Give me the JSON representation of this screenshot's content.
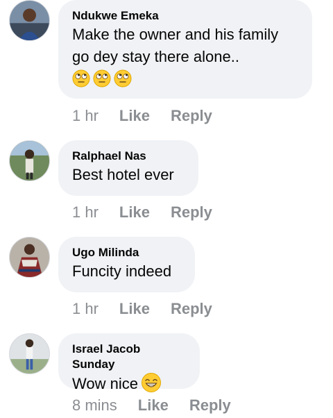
{
  "comments": [
    {
      "author": "Ndukwe Emeka",
      "line1": "Make the owner and his family",
      "line2": "go dey stay there alone..",
      "emojis": [
        "face-with-rolling-eyes",
        "face-with-rolling-eyes",
        "face-with-rolling-eyes"
      ],
      "time": "1 hr",
      "like": "Like",
      "reply": "Reply"
    },
    {
      "author": "Ralphael Nas",
      "text": "Best hotel ever",
      "time": "1 hr",
      "like": "Like",
      "reply": "Reply"
    },
    {
      "author": "Ugo Milinda",
      "text": "Funcity indeed",
      "time": "1 hr",
      "like": "Like",
      "reply": "Reply"
    },
    {
      "author": "Israel Jacob Sunday",
      "text": "Wow nice",
      "emoji": "grinning-face-with-smiling-eyes",
      "time": "8 mins",
      "like": "Like",
      "reply": "Reply"
    }
  ],
  "colors": {
    "bubble": "#f0f2f5",
    "meta": "#8a8d91",
    "text": "#050505",
    "emoji": "#ffcc33"
  }
}
